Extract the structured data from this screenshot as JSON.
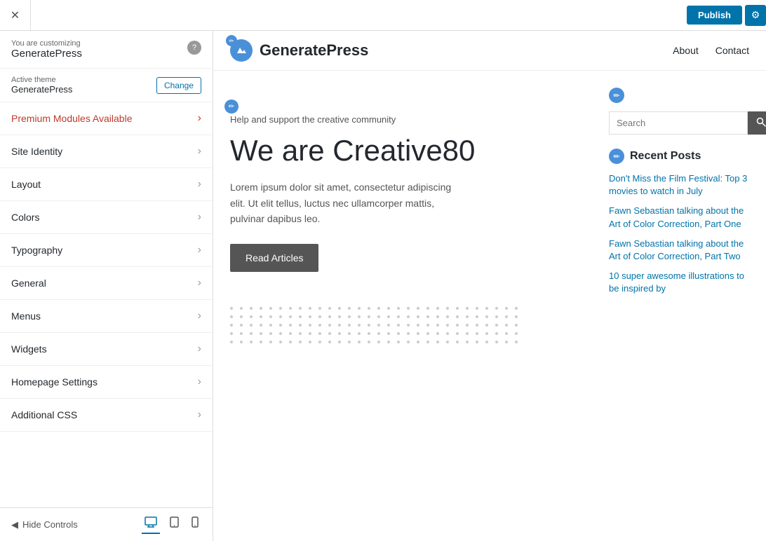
{
  "topBar": {
    "publishLabel": "Publish",
    "gearIcon": "⚙",
    "closeIcon": "✕"
  },
  "sidebar": {
    "customizingLabel": "You are customizing",
    "siteName": "GeneratePress",
    "helpIcon": "?",
    "activeThemeLabel": "Active theme",
    "themeName": "GeneratePress",
    "changeLabel": "Change",
    "items": [
      {
        "label": "Premium Modules Available",
        "premium": true
      },
      {
        "label": "Site Identity",
        "premium": false
      },
      {
        "label": "Layout",
        "premium": false
      },
      {
        "label": "Colors",
        "premium": false
      },
      {
        "label": "Typography",
        "premium": false
      },
      {
        "label": "General",
        "premium": false
      },
      {
        "label": "Menus",
        "premium": false
      },
      {
        "label": "Widgets",
        "premium": false
      },
      {
        "label": "Homepage Settings",
        "premium": false
      },
      {
        "label": "Additional CSS",
        "premium": false
      }
    ],
    "hideControlsLabel": "Hide Controls",
    "leftArrowIcon": "◀"
  },
  "siteHeader": {
    "logoIcon": "✏",
    "siteTitle": "GeneratePress",
    "nav": [
      {
        "label": "About"
      },
      {
        "label": "Contact"
      }
    ],
    "editIcon": "✏"
  },
  "hero": {
    "editIcon": "✏",
    "subtitle": "Help and support the creative community",
    "title": "We are Creative80",
    "description": "Lorem ipsum dolor sit amet, consectetur adipiscing elit. Ut elit tellus, luctus nec ullamcorper mattis, pulvinar dapibus leo.",
    "buttonLabel": "Read Articles"
  },
  "searchWidget": {
    "editIcon": "✏",
    "placeholder": "Search",
    "submitIcon": "🔍"
  },
  "recentPosts": {
    "editIcon": "✏",
    "title": "Recent Posts",
    "posts": [
      {
        "label": "Don't Miss the Film Festival: Top 3 movies to watch in July"
      },
      {
        "label": "Fawn Sebastian talking about the Art of Color Correction, Part One"
      },
      {
        "label": "Fawn Sebastian talking about the Art of Color Correction, Part Two"
      },
      {
        "label": "10 super awesome illustrations to be inspired by"
      }
    ]
  },
  "bottomBar": {
    "hideControlsLabel": "Hide Controls",
    "leftArrowIcon": "◀",
    "desktopIcon": "🖥",
    "tabletIcon": "📱",
    "mobileIcon": "📱"
  }
}
